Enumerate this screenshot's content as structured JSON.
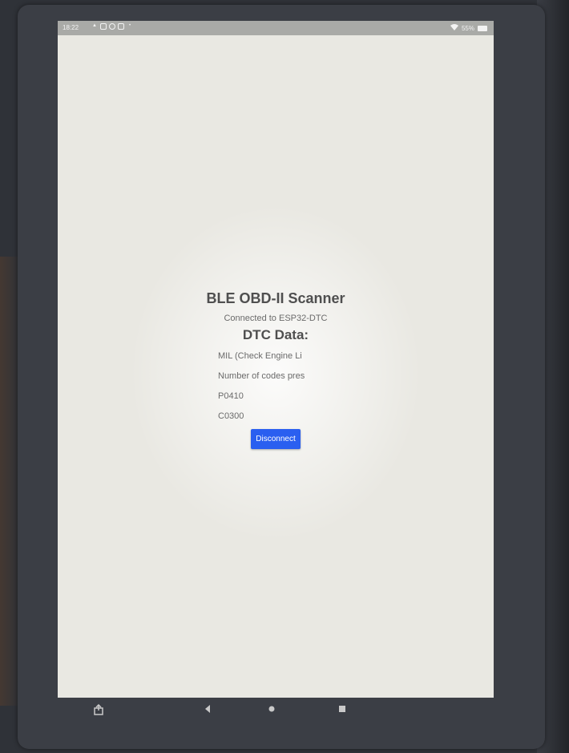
{
  "status_bar": {
    "time": "18:22",
    "icons": [
      "warning-icon",
      "notification-icon",
      "circle-icon",
      "notification-icon",
      "dot-icon"
    ],
    "wifi_icon": "wifi-icon",
    "battery_text": "55%",
    "battery_icon": "battery-icon"
  },
  "app": {
    "title": "BLE OBD-II Scanner",
    "connection_status": "Connected to ESP32-DTC",
    "dtc_heading": "DTC Data:",
    "dtc_items": [
      "MIL (Check Engine Li",
      "Number of codes pres",
      "P0410",
      "C0300"
    ],
    "disconnect_label": "Disconnect"
  },
  "nav": {
    "icons": [
      "screenshot-icon",
      "back-icon",
      "home-icon",
      "recents-icon"
    ]
  },
  "colors": {
    "accent": "#2a5ff0",
    "screen_bg": "#e9e8e2",
    "text": "#5f5f5f"
  }
}
